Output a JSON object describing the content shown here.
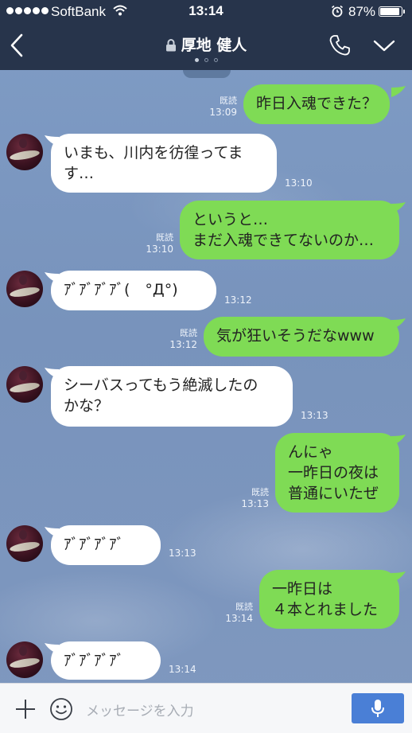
{
  "status_bar": {
    "carrier": "SoftBank",
    "time": "13:14",
    "battery": "87%",
    "battery_level": 0.87
  },
  "header": {
    "title": "厚地 健人",
    "page_index": 0,
    "page_count": 3
  },
  "messages": [
    {
      "side": "out",
      "text": "昨日入魂できた？",
      "read": "既読",
      "time": "13:09"
    },
    {
      "side": "in",
      "text": "いまも、川内を彷徨ってま\nす…",
      "time": "13:10"
    },
    {
      "side": "out",
      "text": "というと…\nまだ入魂できてないのか…",
      "read": "既読",
      "time": "13:10"
    },
    {
      "side": "in",
      "text": "ｱﾞｱﾞｱﾞｱﾞ(　°Д°)",
      "time": "13:12"
    },
    {
      "side": "out",
      "text": "気が狂いそうだなwww",
      "read": "既読",
      "time": "13:12"
    },
    {
      "side": "in",
      "text": "シーバスってもう絶滅したの\nかな？",
      "time": "13:13"
    },
    {
      "side": "out",
      "text": "んにゃ\n一昨日の夜は\n普通にいたぜ",
      "read": "既読",
      "time": "13:13"
    },
    {
      "side": "in",
      "text": "ｱﾞｱﾞｱﾞｱﾞ",
      "time": "13:13"
    },
    {
      "side": "out",
      "text": "一昨日は\n４本とれました",
      "read": "既読",
      "time": "13:14"
    },
    {
      "side": "in",
      "text": "ｱﾞｱﾞｱﾞｱﾞ",
      "time": "13:14"
    }
  ],
  "input": {
    "placeholder": "メッセージを入力"
  },
  "icons": {
    "back": "chevron-left-icon",
    "lock": "lock-icon",
    "call": "phone-icon",
    "menu": "chevron-down-icon",
    "add": "plus-icon",
    "sticker": "smiley-icon",
    "voice": "microphone-icon"
  },
  "colors": {
    "header_bg": "#27344b",
    "outgoing_bubble": "#7fdb55",
    "incoming_bubble": "#ffffff",
    "mic_button": "#4a7fd6"
  }
}
